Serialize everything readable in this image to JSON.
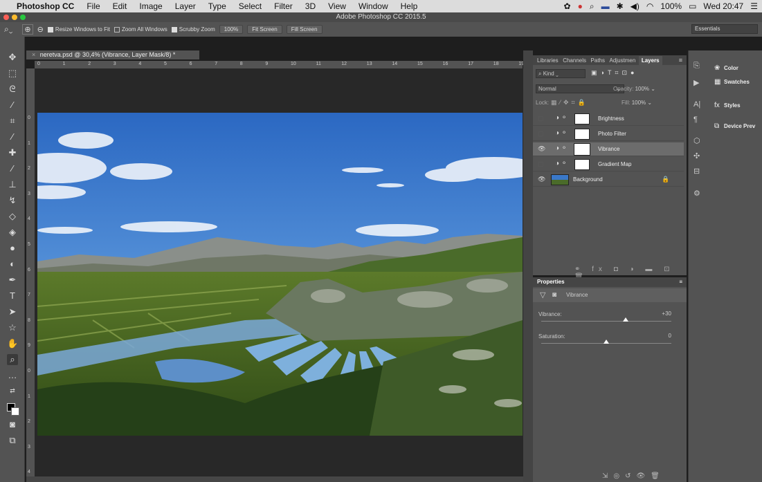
{
  "menubar": {
    "apple": "",
    "app": "Photoshop CC",
    "items": [
      "File",
      "Edit",
      "Image",
      "Layer",
      "Type",
      "Select",
      "Filter",
      "3D",
      "View",
      "Window",
      "Help"
    ],
    "battery": "100%",
    "clock": "Wed 20:47"
  },
  "window_title": "Adobe Photoshop CC 2015.5",
  "options": {
    "resize": "Resize Windows to Fit",
    "zoom_all": "Zoom All Windows",
    "scrubby": "Scrubby Zoom",
    "zoom_level": "100%",
    "fit_screen": "Fit Screen",
    "fill_screen": "Fill Screen",
    "workspace": "Essentials"
  },
  "document": {
    "tab_title": "neretva.psd @ 30,4% (Vibrance, Layer Mask/8) *"
  },
  "rulers": {
    "h_ticks": [
      "0",
      "1",
      "2",
      "3",
      "4",
      "5",
      "6",
      "7",
      "8",
      "9",
      "10",
      "11",
      "12",
      "13",
      "14",
      "15",
      "16",
      "17",
      "18",
      "19"
    ],
    "v_ticks": [
      "0",
      "1",
      "2",
      "3",
      "4",
      "5",
      "6",
      "7",
      "8",
      "9",
      "0",
      "1",
      "2",
      "3",
      "4"
    ]
  },
  "layers_panel": {
    "tabs": [
      "Libraries",
      "Channels",
      "Paths",
      "Adjustmen",
      "Layers"
    ],
    "active_tab": "Layers",
    "kind": "Kind",
    "blend_mode": "Normal",
    "opacity_label": "Opacity:",
    "opacity": "100%",
    "lock_label": "Lock:",
    "fill_label": "Fill:",
    "fill": "100%",
    "layers": [
      {
        "name": "Brightness",
        "visible": false,
        "selected": false
      },
      {
        "name": "Photo Filter",
        "visible": false,
        "selected": false
      },
      {
        "name": "Vibrance",
        "visible": true,
        "selected": true
      },
      {
        "name": "Gradient Map",
        "visible": false,
        "selected": false
      },
      {
        "name": "Background",
        "visible": true,
        "selected": false
      }
    ]
  },
  "properties": {
    "title": "Properties",
    "adjustment": "Vibrance",
    "vibrance_label": "Vibrance:",
    "vibrance_value": "+30",
    "saturation_label": "Saturation:",
    "saturation_value": "0"
  },
  "right_panel": {
    "items": [
      "Color",
      "Swatches",
      "Styles",
      "Device Prev"
    ]
  },
  "colors": {
    "ui_dark": "#535353",
    "sky": "#3a78c8",
    "selected_layer": "#6c6c6c"
  }
}
